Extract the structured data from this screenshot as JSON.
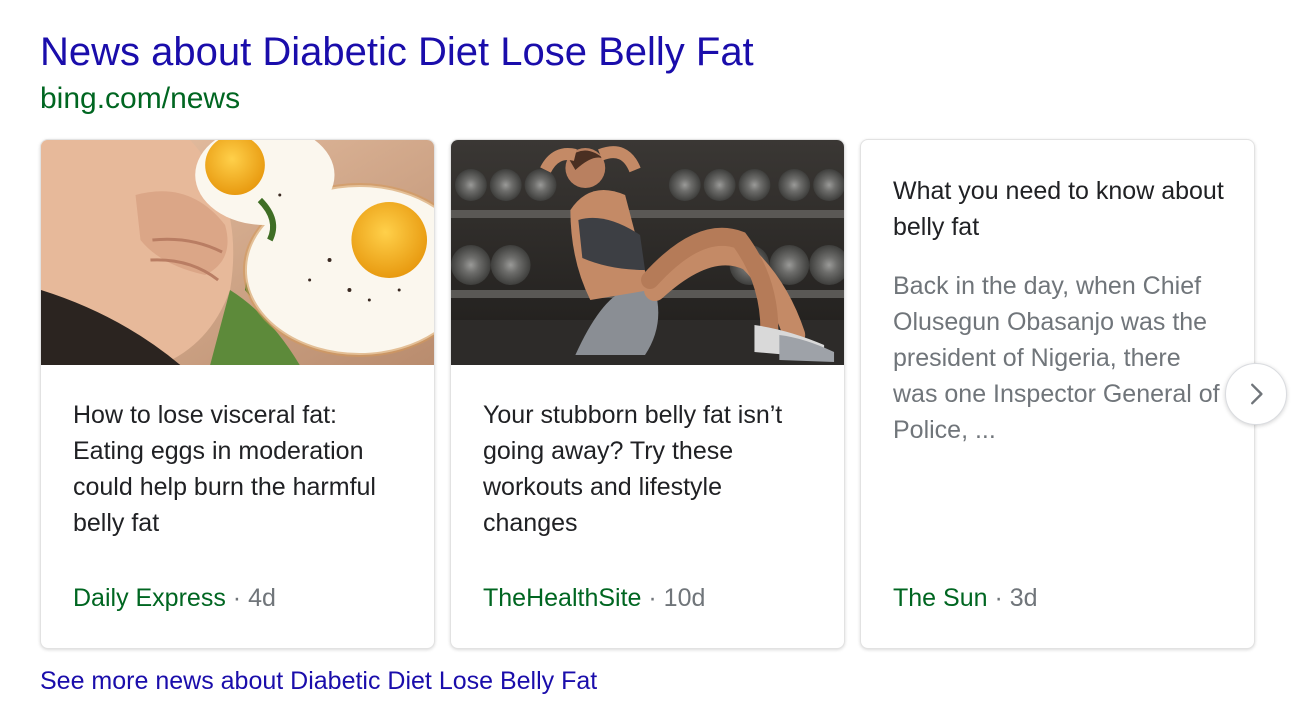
{
  "header": {
    "title": "News about Diabetic Diet Lose Belly Fat",
    "source": "bing.com/news"
  },
  "cards": [
    {
      "title": "How to lose visceral fat: Eating eggs in moderation could help burn the harmful belly fat",
      "publisher": "Daily Express",
      "separator": "·",
      "age": "4d",
      "image": "fried-eggs-belly-photo"
    },
    {
      "title": "Your stubborn belly fat isn’t going away? Try these workouts and lifestyle changes",
      "publisher": "TheHealthSite",
      "separator": "·",
      "age": "10d",
      "image": "woman-doing-crunches-gym-photo"
    },
    {
      "title": "What you need to know about belly fat",
      "snippet": "Back in the day, when Chief Olusegun Obasanjo was the president of Nigeria, there was one Inspector General of Police, ...",
      "publisher": "The Sun",
      "separator": "·",
      "age": "3d"
    }
  ],
  "next_button": {
    "icon": "chevron-right-icon"
  },
  "footer": {
    "see_more": "See more news about Diabetic Diet Lose Belly Fat"
  },
  "colors": {
    "link": "#1a0dab",
    "url_green": "#006621",
    "meta_gray": "#70757a",
    "title_text": "#202124"
  }
}
